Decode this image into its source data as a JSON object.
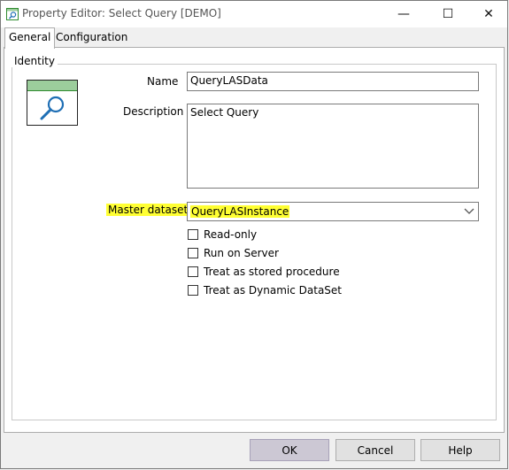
{
  "window": {
    "title": "Property Editor: Select Query [DEMO]",
    "controls": {
      "minimize": "—",
      "maximize": "☐",
      "close": "✕"
    }
  },
  "tabs": [
    {
      "label": "General",
      "selected": true
    },
    {
      "label": "Configuration",
      "selected": false
    }
  ],
  "identity": {
    "group_label": "Identity",
    "name_label": "Name",
    "name_value": "QueryLASData",
    "description_label": "Description",
    "description_value": "Select Query",
    "master_dataset_label": "Master dataset",
    "master_dataset_value": "QueryLASInstance",
    "highlight_color": "#ffff33"
  },
  "options": [
    {
      "label": "Read-only",
      "checked": false
    },
    {
      "label": "Run on Server",
      "checked": false
    },
    {
      "label": "Treat as stored procedure",
      "checked": false
    },
    {
      "label": "Treat as Dynamic DataSet",
      "checked": false
    }
  ],
  "buttons": {
    "ok": "OK",
    "cancel": "Cancel",
    "help": "Help"
  },
  "icons": {
    "title": "query-magnifier-icon",
    "dataset": "query-dataset-icon"
  }
}
